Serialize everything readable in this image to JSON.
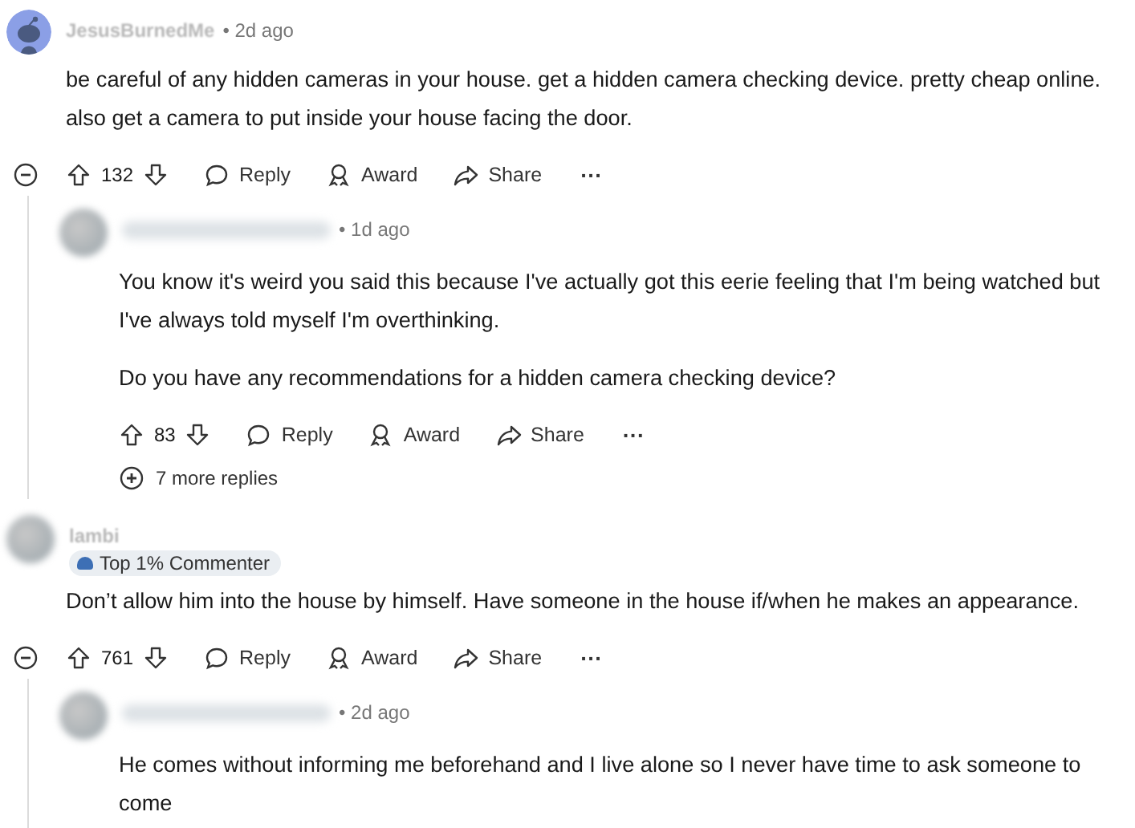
{
  "comments": [
    {
      "author": "JesusBurnedMe",
      "time": "• 2d ago",
      "avatar": {
        "kind": "robot"
      },
      "body": [
        "be careful of any hidden cameras in your house. get a hidden camera checking device. pretty cheap online. also get a camera to put inside your house facing the door."
      ],
      "votes": "132",
      "actions": [
        "Reply",
        "Award",
        "Share"
      ],
      "more": "···",
      "collapsible": true,
      "replies": [
        {
          "time": "• 1d ago",
          "avatar": {
            "kind": "blurred"
          },
          "body": [
            "You know it's weird you said this because I've actually got this eerie feeling that I'm being watched but I've always told myself I'm overthinking.",
            "Do you have any recommendations for a hidden camera checking device?"
          ],
          "votes": "83",
          "actions": [
            "Reply",
            "Award",
            "Share"
          ],
          "more": "···",
          "collapsible": false
        }
      ],
      "more_replies": "7 more replies"
    },
    {
      "author": "lambi",
      "avatar": {
        "kind": "blurred"
      },
      "badge": "Top 1% Commenter",
      "body": [
        "Don’t allow him into the house by himself. Have someone in the house if/when he makes an appearance."
      ],
      "votes": "761",
      "actions": [
        "Reply",
        "Award",
        "Share"
      ],
      "more": "···",
      "collapsible": true,
      "replies": [
        {
          "time": "• 2d ago",
          "avatar": {
            "kind": "blurred"
          },
          "body": [
            "He comes without informing me beforehand and I live alone so I never have time to ask someone to come"
          ]
        }
      ]
    }
  ]
}
